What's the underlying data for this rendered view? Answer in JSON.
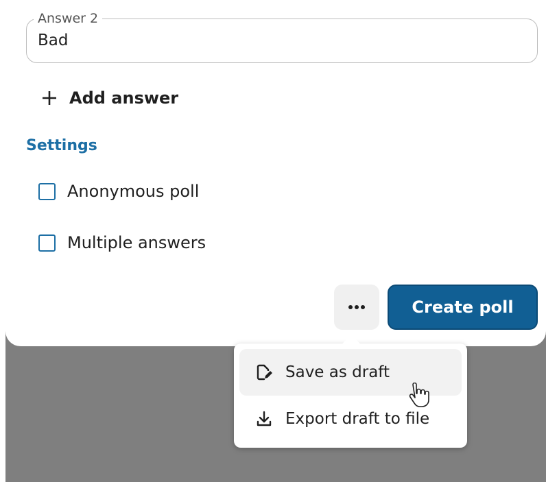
{
  "answer_field": {
    "label": "Answer 2",
    "value": "Bad"
  },
  "add_answer_label": "Add answer",
  "settings": {
    "title": "Settings",
    "options": [
      {
        "label": "Anonymous poll",
        "checked": false
      },
      {
        "label": "Multiple answers",
        "checked": false
      }
    ]
  },
  "actions": {
    "more_icon": "more-horizontal-icon",
    "create_label": "Create poll"
  },
  "menu": {
    "items": [
      {
        "label": "Save as draft",
        "icon": "draft-edit-icon",
        "hovered": true
      },
      {
        "label": "Export draft to file",
        "icon": "download-icon",
        "hovered": false
      }
    ]
  },
  "colors": {
    "accent": "#1d6fa5",
    "primary_button": "#115f94",
    "backdrop": "#7f7f7f"
  }
}
